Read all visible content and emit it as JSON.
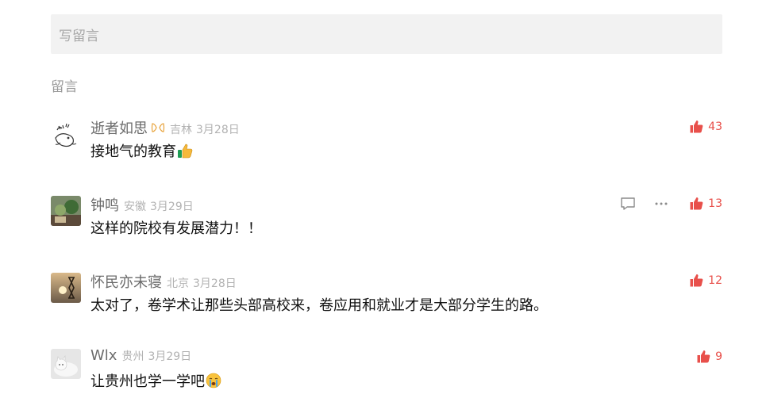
{
  "write_box": {
    "placeholder": "写留言"
  },
  "section": {
    "title": "留言"
  },
  "colors": {
    "like_red": "#e8504b",
    "muted": "#b2b2b2",
    "input_bg": "#f2f2f2"
  },
  "comments": [
    {
      "nickname": "逝者如思",
      "badge_icon": "heart-badge-icon",
      "location": "吉林",
      "date": "3月28日",
      "text": "接地气的教育",
      "emoji": "thumbs-up-emoji",
      "likes": "43",
      "avatar_icon": "sketch-avatar-icon"
    },
    {
      "nickname": "钟鸣",
      "location": "安徽",
      "date": "3月29日",
      "text": "这样的院校有发展潜力！！",
      "likes": "13",
      "avatar_icon": "plant-photo-avatar-icon",
      "actions": [
        "reply-icon",
        "more-icon"
      ]
    },
    {
      "nickname": "怀民亦未寝",
      "location": "北京",
      "date": "3月28日",
      "text": "太对了，卷学术让那些头部高校来，卷应用和就业才是大部分学生的路。",
      "likes": "12",
      "avatar_icon": "hourglass-sunset-avatar-icon"
    },
    {
      "nickname": "Wlx",
      "location": "贵州",
      "date": "3月29日",
      "text": "让贵州也学一学吧",
      "emoji": "crying-face-emoji",
      "likes": "9",
      "avatar_icon": "cat-photo-avatar-icon"
    }
  ]
}
